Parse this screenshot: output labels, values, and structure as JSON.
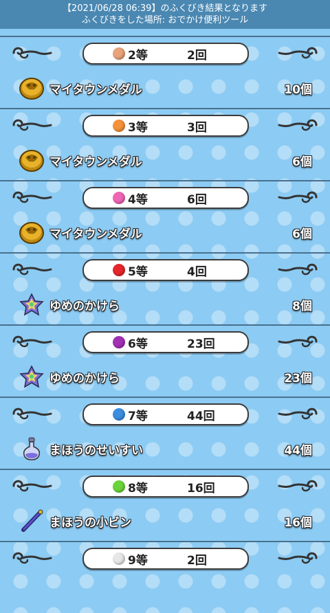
{
  "header": {
    "line1": "【2021/06/28 06:39】のふくびき結果となります",
    "line2": "ふくびきをした場所: おでかけ便利ツール"
  },
  "colors": {
    "header_bg": "#4a88b2",
    "background": "#8ccbf3",
    "separator": "#48708e"
  },
  "sections": [
    {
      "rank": "2等",
      "times": "2回",
      "orb_color": "#e8a37a",
      "item": {
        "name": "マイタウンメダル",
        "count": "10個",
        "icon": "medal-icon"
      }
    },
    {
      "rank": "3等",
      "times": "3回",
      "orb_color": "#f5913a",
      "item": {
        "name": "マイタウンメダル",
        "count": "6個",
        "icon": "medal-icon"
      }
    },
    {
      "rank": "4等",
      "times": "6回",
      "orb_color": "#ee66b4",
      "item": {
        "name": "マイタウンメダル",
        "count": "6個",
        "icon": "medal-icon"
      }
    },
    {
      "rank": "5等",
      "times": "4回",
      "orb_color": "#e5262c",
      "item": {
        "name": "ゆめのかけら",
        "count": "8個",
        "icon": "star-fragment-icon"
      }
    },
    {
      "rank": "6等",
      "times": "23回",
      "orb_color": "#a231b5",
      "item": {
        "name": "ゆめのかけら",
        "count": "23個",
        "icon": "star-fragment-icon"
      }
    },
    {
      "rank": "7等",
      "times": "44回",
      "orb_color": "#3b8de0",
      "item": {
        "name": "まほうのせいすい",
        "count": "44個",
        "icon": "potion-icon"
      }
    },
    {
      "rank": "8等",
      "times": "16回",
      "orb_color": "#6bd43a",
      "item": {
        "name": "まほうの小ビン",
        "count": "16個",
        "icon": "wand-icon"
      }
    },
    {
      "rank": "9等",
      "times": "2回",
      "orb_color": "#e6e6e6"
    }
  ]
}
